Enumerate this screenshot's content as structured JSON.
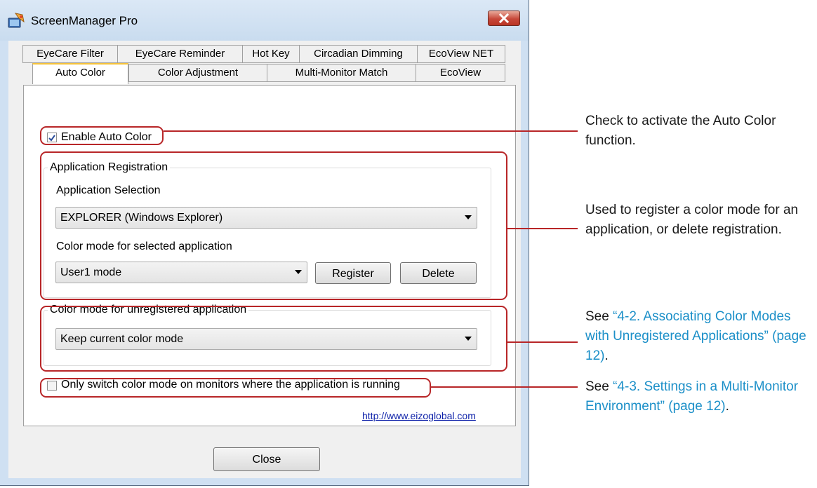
{
  "window": {
    "title": "ScreenManager Pro"
  },
  "tabs": {
    "row1": [
      "EyeCare Filter",
      "EyeCare Reminder",
      "Hot Key",
      "Circadian Dimming",
      "EcoView NET"
    ],
    "row2": [
      "Auto Color",
      "Color Adjustment",
      "Multi-Monitor Match",
      "EcoView"
    ],
    "active": "Auto Color"
  },
  "panel": {
    "enable_auto_color": {
      "label": "Enable Auto Color",
      "checked": true
    },
    "app_registration": {
      "group_title": "Application Registration",
      "selection_label": "Application Selection",
      "selected_app": "EXPLORER (Windows Explorer)",
      "mode_label": "Color mode for selected application",
      "selected_mode": "User1 mode",
      "register_label": "Register",
      "delete_label": "Delete"
    },
    "unregistered": {
      "group_title": "Color mode for unregistered application",
      "selected_mode": "Keep current color mode"
    },
    "only_switch": {
      "label": "Only switch color mode on monitors where the application is running",
      "checked": false
    },
    "website_link": "http://www.eizoglobal.com"
  },
  "footer": {
    "close_label": "Close"
  },
  "annotations": {
    "a1": {
      "text": "Check to activate the Auto Color function."
    },
    "a2": {
      "text": "Used to register a color mode for an application, or delete registration."
    },
    "a3": {
      "prefix": "See ",
      "link": "“4-2. Associating Color Modes with Unregistered Applications” (page 12)",
      "suffix": "."
    },
    "a4": {
      "prefix": "See ",
      "link": "“4-3. Settings in a Multi-Monitor Environment” (page 12)",
      "suffix": "."
    }
  },
  "colors": {
    "highlight": "#b82628",
    "link": "#1b8fc8",
    "active_tab_accent": "#f5c23a"
  }
}
